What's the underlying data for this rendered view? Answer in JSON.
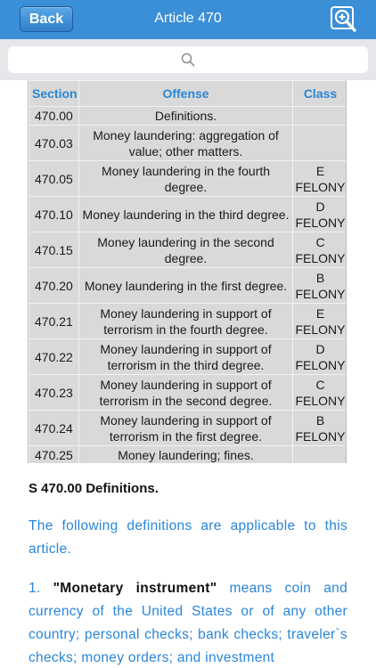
{
  "nav": {
    "back_label": "Back",
    "title": "Article 470",
    "zoom_icon": "zoom-in-icon"
  },
  "search": {
    "placeholder": "",
    "icon": "search-icon"
  },
  "table": {
    "headers": {
      "section": "Section",
      "offense": "Offense",
      "class": "Class"
    },
    "rows": [
      {
        "section": "470.00",
        "offense": "Definitions.",
        "class": ""
      },
      {
        "section": "470.03",
        "offense": "Money laundering: aggregation of value; other matters.",
        "class": ""
      },
      {
        "section": "470.05",
        "offense": "Money laundering in the fourth degree.",
        "class": "E FELONY"
      },
      {
        "section": "470.10",
        "offense": "Money laundering in the third degree.",
        "class": "D FELONY"
      },
      {
        "section": "470.15",
        "offense": "Money laundering in the second degree.",
        "class": "C FELONY"
      },
      {
        "section": "470.20",
        "offense": "Money laundering in the first degree.",
        "class": "B FELONY"
      },
      {
        "section": "470.21",
        "offense": "Money laundering in support of terrorism in the fourth degree.",
        "class": "E FELONY"
      },
      {
        "section": "470.22",
        "offense": "Money laundering in support of terrorism in the third degree.",
        "class": "D FELONY"
      },
      {
        "section": "470.23",
        "offense": "Money laundering in support of terrorism in the second degree.",
        "class": "C FELONY"
      },
      {
        "section": "470.24",
        "offense": "Money laundering in support of terrorism in the first degree.",
        "class": "B FELONY"
      },
      {
        "section": "470.25",
        "offense": "Money laundering; fines.",
        "class": ""
      }
    ]
  },
  "content": {
    "heading": "S 470.00 Definitions.",
    "intro": "The following definitions are applicable to this article.",
    "def1_number": "1.",
    "def1_term": "\"Monetary instrument\"",
    "def1_text": "means coin and currency of the United States or of any other country; personal checks; bank checks; traveler`s checks; money orders; and investment"
  },
  "colors": {
    "navbar": "#3a8fd6",
    "accent": "#2a86d8",
    "table_bg": "#d9d9d9"
  }
}
